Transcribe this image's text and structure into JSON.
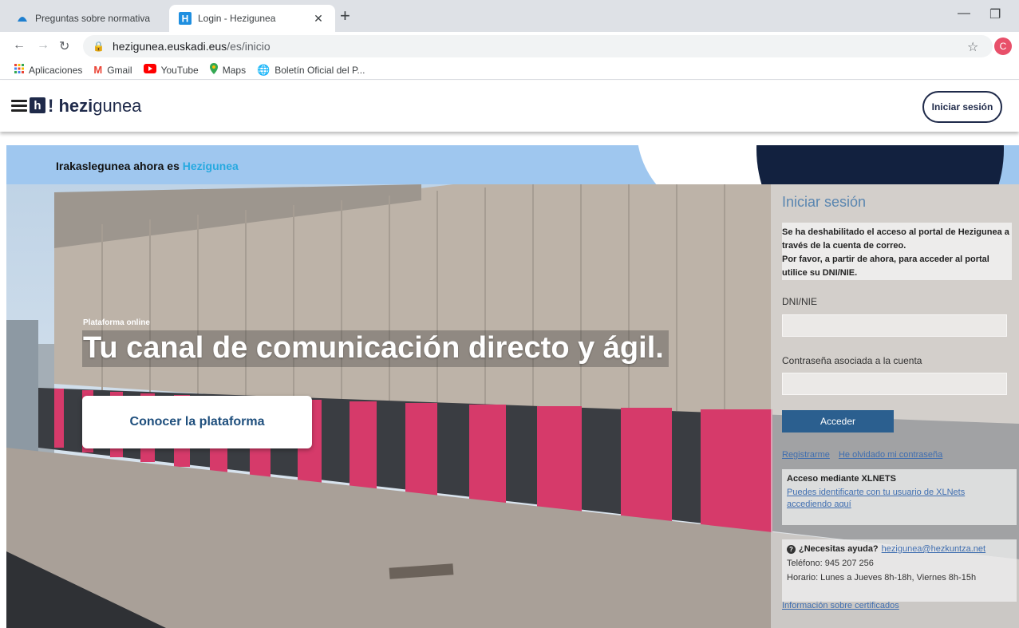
{
  "browser": {
    "tabs": [
      {
        "title": "Preguntas sobre normativa",
        "active": false
      },
      {
        "title": "Login - Hezigunea",
        "active": true
      }
    ],
    "url_host": "hezigunea.euskadi.eus",
    "url_path": "/es/inicio",
    "profile_initial": "C",
    "bookmarks": [
      {
        "label": "Aplicaciones",
        "icon": "apps-grid-icon"
      },
      {
        "label": "Gmail",
        "icon": "gmail-icon"
      },
      {
        "label": "YouTube",
        "icon": "youtube-icon"
      },
      {
        "label": "Maps",
        "icon": "maps-pin-icon"
      },
      {
        "label": "Boletín Oficial del P...",
        "icon": "globe-icon"
      }
    ]
  },
  "header": {
    "logo_letter": "h",
    "logo_bold": "! hezi",
    "logo_rest": "gunea",
    "login_button": "Iniciar sesión"
  },
  "banner": {
    "text": "Irakaslegunea ahora es",
    "highlight": "Hezigunea"
  },
  "hero": {
    "kicker": "Plataforma online",
    "headline": "Tu canal de comunicación directo y ágil.",
    "cta": "Conocer la plataforma"
  },
  "login": {
    "title": "Iniciar sesión",
    "message_1": "Se ha deshabilitado el acceso al portal de Hezigunea a través de la cuenta de correo.",
    "message_2": "Por favor, a partir de ahora, para acceder al portal utilice su DNI/NIE.",
    "dni_label": "DNI/NIE",
    "dni_value": "",
    "password_label": "Contraseña asociada a la cuenta",
    "password_value": "",
    "submit": "Acceder",
    "register_link": "Registrarme",
    "forgot_link": "He olvidado mi contraseña",
    "xlnets_title": "Acceso mediante XLNETS",
    "xlnets_link": "Puedes identificarte con tu usuario de XLNets accediendo aquí",
    "help_question": "¿Necesitas ayuda?",
    "help_email": "hezigunea@hezkuntza.net",
    "phone": "Teléfono: 945 207 256",
    "hours": "Horario: Lunes a Jueves 8h-18h, Viernes 8h-15h",
    "certificates_link": "Información sobre certificados"
  },
  "colors": {
    "brand_navy": "#1f2a4a",
    "banner_blue": "#9fc7ef",
    "highlight_blue": "#26a9e0",
    "button_blue": "#2b5f8f",
    "facade_pink": "#d63a6a"
  }
}
